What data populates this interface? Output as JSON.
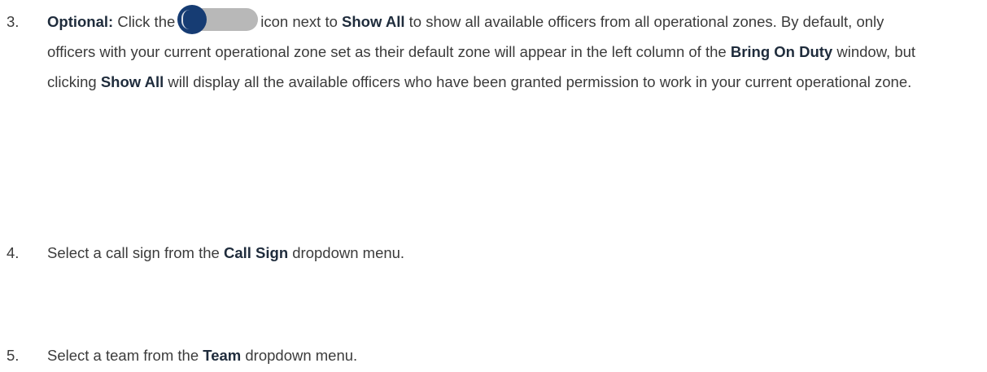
{
  "steps": [
    {
      "number": "3.",
      "optional_label": "Optional:",
      "text_before_icon": "Click the",
      "text_after_icon": "icon next to",
      "show_all_1": "Show All",
      "text_a": "to show all available officers from all operational zones. By default, only officers with your current operational zone set as their default zone will appear in the left column of the",
      "bring_on_duty": "Bring On Duty",
      "text_b": "window, but clicking",
      "show_all_2": "Show All",
      "text_c": "will display all the available officers who have been granted permission to work in your current operational zone."
    },
    {
      "number": "4.",
      "text_before": "Select a call sign from the",
      "bold": "Call Sign",
      "text_after": "dropdown menu."
    },
    {
      "number": "5.",
      "text_before": "Select a team from the",
      "bold": "Team",
      "text_after": "dropdown menu."
    }
  ],
  "toggle": {
    "icon": "toggle-switch-icon",
    "state": "off",
    "knob_color": "#163c73",
    "track_color": "#b8b8b8"
  },
  "colors": {
    "body_text": "#3b3b3b",
    "bold_text": "#1f2c3c"
  }
}
